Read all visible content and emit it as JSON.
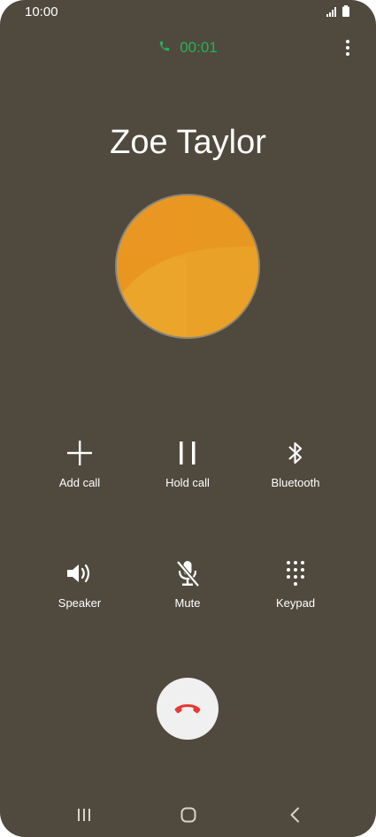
{
  "status_bar": {
    "time": "10:00",
    "icons": [
      "signal-icon",
      "battery-icon"
    ]
  },
  "call": {
    "timer": "00:01",
    "timer_icon": "phone-icon",
    "timer_color": "#22b35a",
    "contact_name": "Zoe Taylor"
  },
  "actions": [
    {
      "label": "Add call",
      "icon": "plus-icon"
    },
    {
      "label": "Hold call",
      "icon": "pause-icon"
    },
    {
      "label": "Bluetooth",
      "icon": "bluetooth-icon"
    },
    {
      "label": "Speaker",
      "icon": "speaker-icon"
    },
    {
      "label": "Mute",
      "icon": "mic-off-icon"
    },
    {
      "label": "Keypad",
      "icon": "keypad-icon"
    }
  ],
  "end_call": {
    "icon": "hang-up-icon",
    "color": "#e53935"
  },
  "nav": {
    "items": [
      "recent-apps-icon",
      "home-icon",
      "back-icon"
    ]
  },
  "colors": {
    "background": "#504a3e",
    "avatar": "#e99a25"
  }
}
